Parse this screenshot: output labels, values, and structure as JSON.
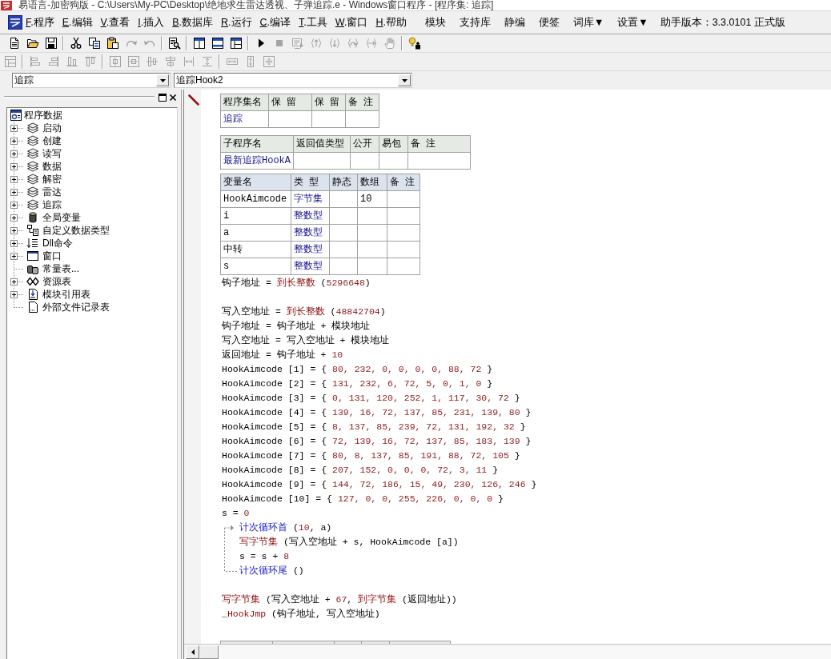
{
  "window": {
    "title": "易语言-加密狗版 - C:\\Users\\My-PC\\Desktop\\绝地求生雷达透视、子弹追踪.e - Windows窗口程序 - [程序集: 追踪]"
  },
  "menu_bar": {
    "menus": [
      {
        "key": "F",
        "label": ".程序"
      },
      {
        "key": "E",
        "label": ".编辑"
      },
      {
        "key": "V",
        "label": ".查看"
      },
      {
        "key": "I",
        "label": ".插入"
      },
      {
        "key": "B",
        "label": ".数据库"
      },
      {
        "key": "R",
        "label": ".运行"
      },
      {
        "key": "C",
        "label": ".编译"
      },
      {
        "key": "T",
        "label": ".工具"
      },
      {
        "key": "W",
        "label": ".窗口"
      },
      {
        "key": "H",
        "label": ".帮助"
      }
    ],
    "tools": [
      {
        "label": "模块"
      },
      {
        "label": "支持库"
      },
      {
        "label": "静编"
      },
      {
        "label": "便签"
      },
      {
        "label": "词库▼"
      },
      {
        "label": "设置▼"
      }
    ],
    "version": "助手版本：3.3.0101 正式版"
  },
  "toolbars": [
    {
      "groups": [
        {
          "buttons": [
            {
              "kind": "new",
              "disabled": false
            },
            {
              "kind": "open",
              "disabled": false
            },
            {
              "kind": "save",
              "disabled": false
            }
          ]
        },
        {
          "buttons": [
            {
              "kind": "cut",
              "disabled": false
            },
            {
              "kind": "copy",
              "disabled": false
            },
            {
              "kind": "paste",
              "disabled": false
            },
            {
              "kind": "redo",
              "disabled": true
            },
            {
              "kind": "undo",
              "disabled": true
            }
          ]
        },
        {
          "buttons": [
            {
              "kind": "find",
              "disabled": false
            }
          ]
        },
        {
          "buttons": [
            {
              "kind": "layout-top",
              "disabled": false
            },
            {
              "kind": "layout-bottom",
              "disabled": false
            },
            {
              "kind": "layout-side",
              "disabled": false
            }
          ]
        },
        {
          "buttons": [
            {
              "kind": "run",
              "disabled": false
            },
            {
              "kind": "stop",
              "disabled": true
            },
            {
              "kind": "screen",
              "disabled": true
            },
            {
              "kind": "step-into",
              "disabled": true
            },
            {
              "kind": "step-out",
              "disabled": true
            },
            {
              "kind": "step-over",
              "disabled": true
            },
            {
              "kind": "run-to",
              "disabled": true
            },
            {
              "kind": "hand",
              "disabled": true
            }
          ]
        },
        {
          "buttons": [
            {
              "kind": "helper",
              "disabled": false
            }
          ]
        }
      ]
    },
    {
      "groups": [
        {
          "buttons": [
            {
              "kind": "grid",
              "disabled": true
            }
          ]
        },
        {
          "buttons": [
            {
              "kind": "align-left",
              "disabled": true
            },
            {
              "kind": "align-right",
              "disabled": true
            },
            {
              "kind": "align-top",
              "disabled": true
            },
            {
              "kind": "align-bottom",
              "disabled": true
            }
          ]
        },
        {
          "buttons": [
            {
              "kind": "center-h",
              "disabled": true
            },
            {
              "kind": "center-v",
              "disabled": true
            },
            {
              "kind": "spread-h",
              "disabled": true
            },
            {
              "kind": "spread-v",
              "disabled": true
            },
            {
              "kind": "gap-h",
              "disabled": true
            },
            {
              "kind": "gap-v",
              "disabled": true
            }
          ]
        },
        {
          "buttons": [
            {
              "kind": "same-width",
              "disabled": true
            },
            {
              "kind": "same-height",
              "disabled": true
            },
            {
              "kind": "same-size",
              "disabled": true
            }
          ]
        }
      ]
    }
  ],
  "selectors": [
    {
      "value": "追踪"
    },
    {
      "value": "追踪Hook2"
    }
  ],
  "project_tree": {
    "root": {
      "label": "程序数据",
      "kind": "program",
      "children": [
        {
          "label": "启动",
          "kind": "assembly",
          "expanded": false
        },
        {
          "label": "创建",
          "kind": "assembly",
          "expanded": false
        },
        {
          "label": "读写",
          "kind": "assembly",
          "expanded": false
        },
        {
          "label": "数据",
          "kind": "assembly",
          "expanded": false
        },
        {
          "label": "解密",
          "kind": "assembly",
          "expanded": false
        },
        {
          "label": "雷达",
          "kind": "assembly",
          "expanded": false
        },
        {
          "label": "追踪",
          "kind": "assembly",
          "expanded": false
        },
        {
          "label": "全局变量",
          "kind": "global",
          "expanded": false
        },
        {
          "label": "自定义数据类型",
          "kind": "datatype",
          "expanded": false
        },
        {
          "label": "Dll命令",
          "kind": "dll",
          "expanded": false
        },
        {
          "label": "窗口",
          "kind": "window",
          "expanded": false
        },
        {
          "label": "常量表...",
          "kind": "constant"
        },
        {
          "label": "资源表",
          "kind": "resource",
          "expanded": false
        },
        {
          "label": "模块引用表",
          "kind": "module",
          "expanded": false
        },
        {
          "label": "外部文件记录表",
          "kind": "file"
        }
      ]
    }
  },
  "editor": {
    "assembly_table": {
      "columns": [
        "程序集名",
        "保 留",
        "保 留",
        "备 注"
      ],
      "rows": [
        {
          "name": "追踪"
        }
      ]
    },
    "subroutine_table": {
      "columns": [
        "子程序名",
        "返回值类型",
        "公开",
        "易包",
        "备 注"
      ],
      "rows": [
        {
          "name": "最新追踪HookA"
        }
      ]
    },
    "variable_table": {
      "columns": [
        "变量名",
        "类 型",
        "静态",
        "数组",
        "备 注"
      ],
      "rows": [
        {
          "name": "HookAimcode",
          "type": "字节集",
          "array": "10"
        },
        {
          "name": "i",
          "type": "整数型"
        },
        {
          "name": "a",
          "type": "整数型"
        },
        {
          "name": "中转",
          "type": "整数型"
        },
        {
          "name": "s",
          "type": "整数型"
        }
      ]
    },
    "code": [
      {
        "kind": "line",
        "tokens": [
          {
            "kind": "plain",
            "text": "钩子地址 = "
          },
          {
            "kind": "command",
            "text": "到长整数"
          },
          {
            "kind": "plain",
            "text": " ("
          },
          {
            "kind": "number",
            "text": "5296648"
          },
          {
            "kind": "plain",
            "text": ")"
          }
        ]
      },
      {
        "kind": "blank"
      },
      {
        "kind": "line",
        "tokens": [
          {
            "kind": "plain",
            "text": "写入空地址 = "
          },
          {
            "kind": "command",
            "text": "到长整数"
          },
          {
            "kind": "plain",
            "text": " ("
          },
          {
            "kind": "number",
            "text": "48842704"
          },
          {
            "kind": "plain",
            "text": ")"
          }
        ]
      },
      {
        "kind": "line",
        "tokens": [
          {
            "kind": "plain",
            "text": "钩子地址 = 钩子地址 + 模块地址"
          }
        ]
      },
      {
        "kind": "line",
        "tokens": [
          {
            "kind": "plain",
            "text": "写入空地址 = 写入空地址 + 模块地址"
          }
        ]
      },
      {
        "kind": "line",
        "tokens": [
          {
            "kind": "plain",
            "text": "返回地址 = 钩子地址 + "
          },
          {
            "kind": "number",
            "text": "10"
          }
        ]
      },
      {
        "kind": "line",
        "tokens": [
          {
            "kind": "plain",
            "text": "HookAimcode [1] = { "
          },
          {
            "kind": "number",
            "text": "80, 232, 0, 0, 0, 0, 88, 72"
          },
          {
            "kind": "plain",
            "text": " }"
          }
        ]
      },
      {
        "kind": "line",
        "tokens": [
          {
            "kind": "plain",
            "text": "HookAimcode [2] = { "
          },
          {
            "kind": "number",
            "text": "131, 232, 6, 72, 5, 0, 1, 0"
          },
          {
            "kind": "plain",
            "text": " }"
          }
        ]
      },
      {
        "kind": "line",
        "tokens": [
          {
            "kind": "plain",
            "text": "HookAimcode [3] = { "
          },
          {
            "kind": "number",
            "text": "0, 131, 120, 252, 1, 117, 30, 72"
          },
          {
            "kind": "plain",
            "text": " }"
          }
        ]
      },
      {
        "kind": "line",
        "tokens": [
          {
            "kind": "plain",
            "text": "HookAimcode [4] = { "
          },
          {
            "kind": "number",
            "text": "139, 16, 72, 137, 85, 231, 139, 80"
          },
          {
            "kind": "plain",
            "text": " }"
          }
        ]
      },
      {
        "kind": "line",
        "tokens": [
          {
            "kind": "plain",
            "text": "HookAimcode [5] = { "
          },
          {
            "kind": "number",
            "text": "8, 137, 85, 239, 72, 131, 192, 32"
          },
          {
            "kind": "plain",
            "text": " }"
          }
        ]
      },
      {
        "kind": "line",
        "tokens": [
          {
            "kind": "plain",
            "text": "HookAimcode [6] = { "
          },
          {
            "kind": "number",
            "text": "72, 139, 16, 72, 137, 85, 183, 139"
          },
          {
            "kind": "plain",
            "text": " }"
          }
        ]
      },
      {
        "kind": "line",
        "tokens": [
          {
            "kind": "plain",
            "text": "HookAimcode [7] = { "
          },
          {
            "kind": "number",
            "text": "80, 8, 137, 85, 191, 88, 72, 105"
          },
          {
            "kind": "plain",
            "text": " }"
          }
        ]
      },
      {
        "kind": "line",
        "tokens": [
          {
            "kind": "plain",
            "text": "HookAimcode [8] = { "
          },
          {
            "kind": "number",
            "text": "207, 152, 0, 0, 0, 72, 3, 11"
          },
          {
            "kind": "plain",
            "text": " }"
          }
        ]
      },
      {
        "kind": "line",
        "tokens": [
          {
            "kind": "plain",
            "text": "HookAimcode [9] = { "
          },
          {
            "kind": "number",
            "text": "144, 72, 186, 15, 49, 230, 126, 246"
          },
          {
            "kind": "plain",
            "text": " }"
          }
        ]
      },
      {
        "kind": "line",
        "tokens": [
          {
            "kind": "plain",
            "text": "HookAimcode [10] = { "
          },
          {
            "kind": "number",
            "text": "127, 0, 0, 255, 226, 0, 0, 0"
          },
          {
            "kind": "plain",
            "text": " }"
          }
        ]
      },
      {
        "kind": "line",
        "tokens": [
          {
            "kind": "plain",
            "text": "s = "
          },
          {
            "kind": "number",
            "text": "0"
          }
        ]
      },
      {
        "kind": "loop",
        "head": [
          {
            "kind": "flow",
            "text": "计次循环首"
          },
          {
            "kind": "plain",
            "text": " ("
          },
          {
            "kind": "number",
            "text": "10"
          },
          {
            "kind": "plain",
            "text": ", a)"
          }
        ],
        "children": [
          {
            "kind": "line",
            "tokens": [
              {
                "kind": "command",
                "text": "写字节集"
              },
              {
                "kind": "plain",
                "text": " (写入空地址 + s, HookAimcode [a])"
              }
            ]
          },
          {
            "kind": "line",
            "tokens": [
              {
                "kind": "plain",
                "text": "s = s + "
              },
              {
                "kind": "number",
                "text": "8"
              }
            ]
          }
        ],
        "tail": [
          {
            "kind": "flow",
            "text": "计次循环尾"
          },
          {
            "kind": "plain",
            "text": " ()"
          }
        ]
      },
      {
        "kind": "blank"
      },
      {
        "kind": "line",
        "tokens": [
          {
            "kind": "command",
            "text": "写字节集"
          },
          {
            "kind": "plain",
            "text": " (写入空地址 + "
          },
          {
            "kind": "number",
            "text": "67"
          },
          {
            "kind": "plain",
            "text": ", "
          },
          {
            "kind": "command",
            "text": "到字节集"
          },
          {
            "kind": "plain",
            "text": " (返回地址))"
          }
        ]
      },
      {
        "kind": "line",
        "tokens": [
          {
            "kind": "command",
            "text": "_HookJmp"
          },
          {
            "kind": "plain",
            "text": " (钩子地址, 写入空地址)"
          }
        ]
      },
      {
        "kind": "blank"
      }
    ]
  }
}
